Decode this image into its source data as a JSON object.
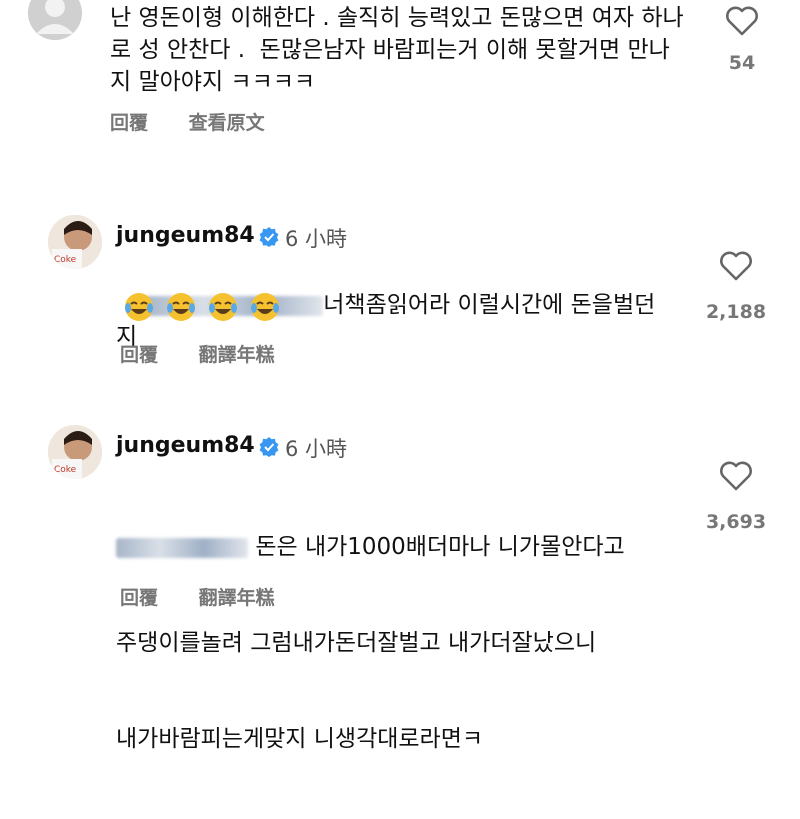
{
  "comments": [
    {
      "username": "",
      "time": "",
      "text": "난 영돈이형 이해한다 . 솔직히 능력있고 돈많으면 여자 하나\n로 성 안찬다 .  돈많은남자 바람피는거 이해 못할거면 만나\n지 말아야지 ㅋㅋㅋㅋ",
      "likes": "54",
      "reply_label": "回覆",
      "translate_label": "查看原文"
    },
    {
      "username": "jungeum84",
      "time": "6 小時",
      "text_visible": "너책좀읽어라 이럴시간에 돈을벌던지",
      "emojis": [
        "laughing-tears-emoji",
        "laughing-tears-emoji",
        "laughing-tears-emoji",
        "laughing-tears-emoji"
      ],
      "likes": "2,188",
      "reply_label": "回覆",
      "translate_label": "翻譯年糕"
    },
    {
      "username": "jungeum84",
      "time": "6 小時",
      "line1": "돈은 내가1000배더마나 니가몰안다고",
      "line2": "주댕이를놀려 그럼내가돈더잘벌고 내가더잘났으니",
      "line3": "내가바람피는게맞지 니생각대로라면ㅋ",
      "likes": "3,693",
      "reply_label": "回覆",
      "translate_label": "翻譯年糕"
    }
  ],
  "colors": {
    "verified": "#3897f0",
    "muted": "#777777",
    "text": "#111111"
  }
}
